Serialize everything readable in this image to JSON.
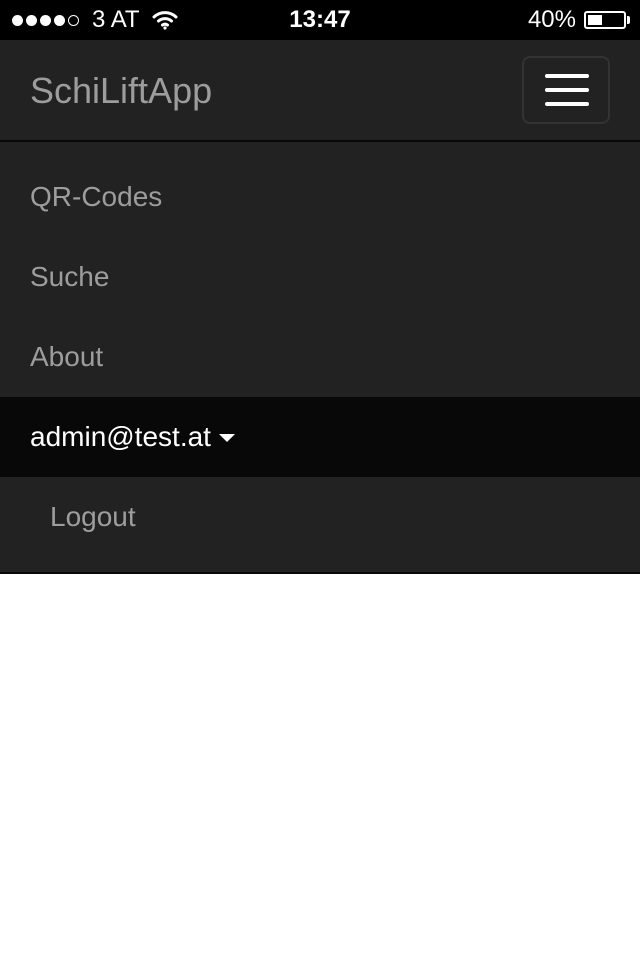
{
  "status_bar": {
    "carrier": "3 AT",
    "signal_bars_filled": 4,
    "signal_bars_total": 5,
    "time": "13:47",
    "battery_percent_text": "40%",
    "battery_level": 0.4
  },
  "navbar": {
    "brand": "SchiLiftApp",
    "toggle_icon": "hamburger-menu-icon"
  },
  "menu": {
    "items": [
      {
        "label": "QR-Codes"
      },
      {
        "label": "Suche"
      },
      {
        "label": "About"
      }
    ],
    "user_dropdown": {
      "label": "admin@test.at",
      "icon": "caret-down-icon",
      "items": [
        {
          "label": "Logout"
        }
      ]
    }
  },
  "colors": {
    "navbar_bg": "#222222",
    "active_bg": "#080808",
    "link": "#9d9d9d",
    "active_link": "#ffffff"
  }
}
